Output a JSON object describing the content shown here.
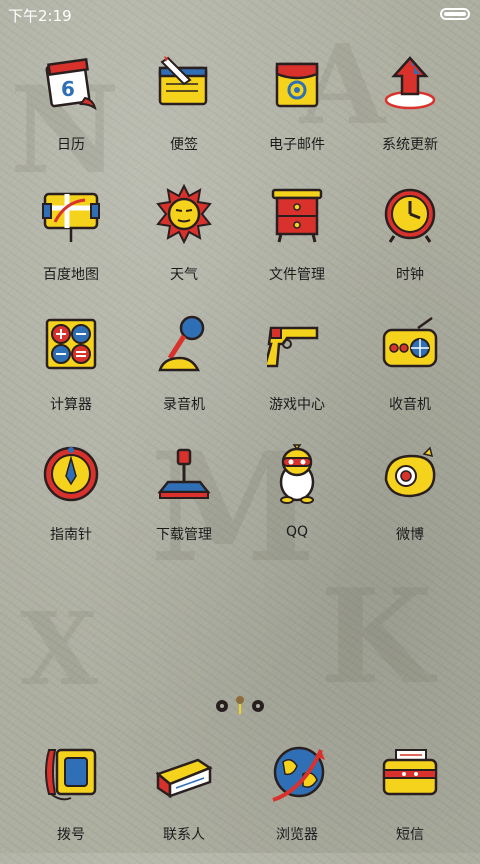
{
  "status_bar": {
    "time": "下午2:19"
  },
  "apps": [
    {
      "label": "日历",
      "icon": "calendar-icon"
    },
    {
      "label": "便签",
      "icon": "notes-icon"
    },
    {
      "label": "电子邮件",
      "icon": "email-icon"
    },
    {
      "label": "系统更新",
      "icon": "system-update-icon"
    },
    {
      "label": "百度地图",
      "icon": "map-icon"
    },
    {
      "label": "天气",
      "icon": "weather-sun-icon"
    },
    {
      "label": "文件管理",
      "icon": "file-manager-icon"
    },
    {
      "label": "时钟",
      "icon": "clock-icon"
    },
    {
      "label": "计算器",
      "icon": "calculator-icon"
    },
    {
      "label": "录音机",
      "icon": "microphone-icon"
    },
    {
      "label": "游戏中心",
      "icon": "gun-icon"
    },
    {
      "label": "收音机",
      "icon": "radio-icon"
    },
    {
      "label": "指南针",
      "icon": "compass-icon"
    },
    {
      "label": "下载管理",
      "icon": "joystick-icon"
    },
    {
      "label": "QQ",
      "icon": "qq-penguin-icon"
    },
    {
      "label": "微博",
      "icon": "weibo-eye-icon"
    }
  ],
  "dock": [
    {
      "label": "拨号",
      "icon": "phone-icon"
    },
    {
      "label": "联系人",
      "icon": "contacts-book-icon"
    },
    {
      "label": "浏览器",
      "icon": "browser-globe-icon"
    },
    {
      "label": "短信",
      "icon": "sms-icon"
    }
  ],
  "calendar_day": "6",
  "colors": {
    "accent_yellow": "#f5d21b",
    "accent_red": "#d9322c",
    "accent_blue": "#2f6fb5",
    "outline": "#2a1f1f"
  }
}
